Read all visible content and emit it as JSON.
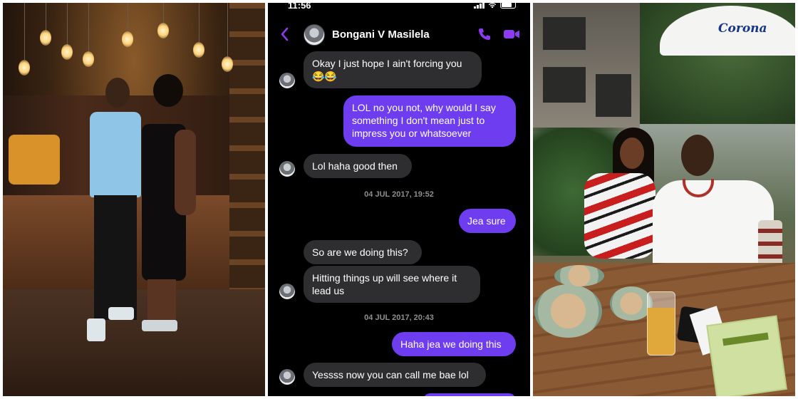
{
  "status_bar": {
    "time": "11:56"
  },
  "chat": {
    "contact_name": "Bongani V Masilela",
    "messages": [
      {
        "dir": "in",
        "text": "Okay I just hope I ain't forcing you 😂😂"
      },
      {
        "dir": "out",
        "text": "LOL no you not, why would I say something I don't mean just to impress you or whatsoever"
      },
      {
        "dir": "in",
        "text": "Lol haha good then"
      },
      {
        "dir": "out",
        "text": "Jea sure"
      },
      {
        "dir": "in",
        "text": "So are we doing this?"
      },
      {
        "dir": "in",
        "text": "Hitting things up will see where it lead us"
      },
      {
        "dir": "out",
        "text": "Haha jea we doing this"
      },
      {
        "dir": "in",
        "text": "Yessss now you can call me bae lol"
      }
    ],
    "timestamps": [
      "04 JUL 2017, 19:52",
      "04 JUL 2017, 20:43"
    ],
    "colors": {
      "accent": "#8b3cf0",
      "incoming": "#2e2e30",
      "background": "#000000"
    }
  },
  "photo_right": {
    "umbrella_brand": "Corona"
  }
}
